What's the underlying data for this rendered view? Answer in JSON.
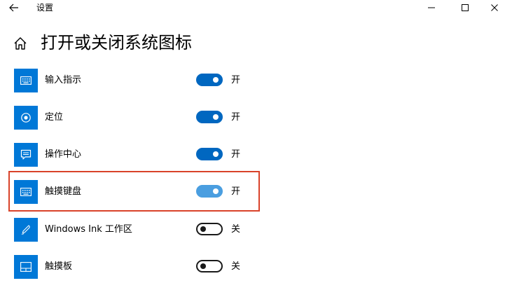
{
  "window": {
    "title": "设置",
    "back_icon": "back-arrow-icon",
    "minimize_icon": "minimize-icon",
    "maximize_icon": "maximize-icon",
    "close_icon": "close-icon"
  },
  "header": {
    "home_icon": "home-icon",
    "title": "打开或关闭系统图标"
  },
  "items": [
    {
      "label": "输入指示",
      "icon": "keyboard-icon",
      "on": true,
      "state": "开"
    },
    {
      "label": "定位",
      "icon": "location-icon",
      "on": true,
      "state": "开"
    },
    {
      "label": "操作中心",
      "icon": "action-center-icon",
      "on": true,
      "state": "开"
    },
    {
      "label": "触摸键盘",
      "icon": "touch-keyboard-icon",
      "on": true,
      "state": "开",
      "highlighted": true
    },
    {
      "label": "Windows Ink 工作区",
      "icon": "pen-icon",
      "on": false,
      "state": "关"
    },
    {
      "label": "触摸板",
      "icon": "touchpad-icon",
      "on": false,
      "state": "关"
    }
  ],
  "colors": {
    "accent": "#0078d7",
    "toggle_on": "#0067c0",
    "highlight_border": "#d9432a"
  }
}
